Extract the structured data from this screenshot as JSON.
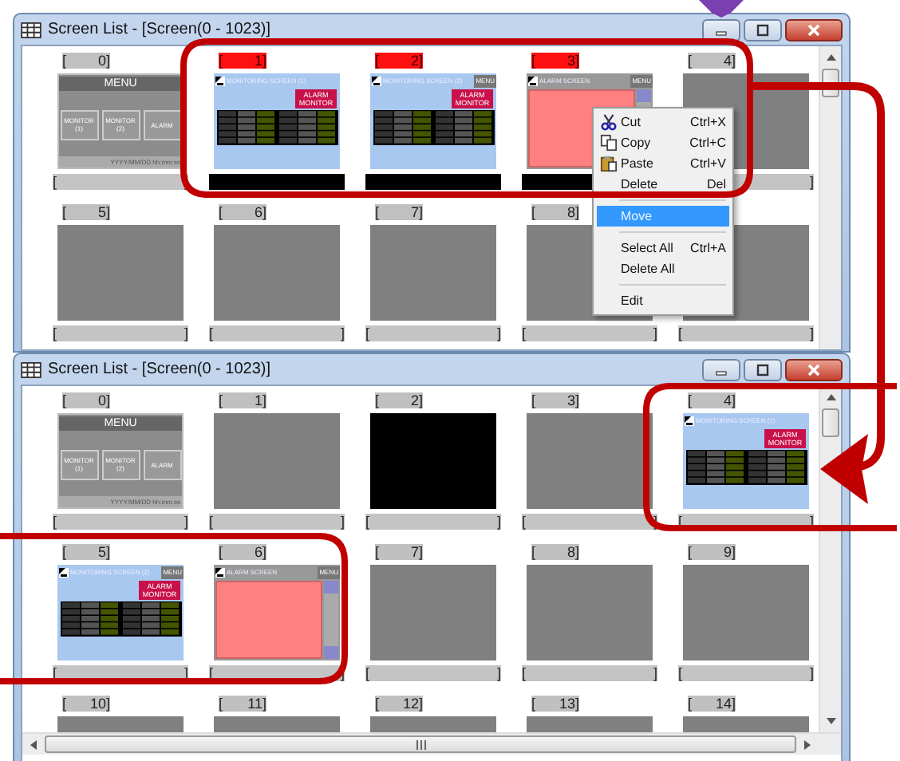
{
  "brackets": {
    "open": "[",
    "close": "]"
  },
  "windows": [
    {
      "title": "Screen List - [Screen(0 - 1023)]",
      "rows": [
        {
          "cut_off": false,
          "items": [
            {
              "number": "0",
              "kind": "menu",
              "selected": false,
              "header": "MENU",
              "buttons": [
                "MONITOR (1)",
                "MONITOR (2)",
                "ALARM"
              ],
              "footer": "YYYY/MM/DD hh:mm:ss"
            },
            {
              "number": "1",
              "kind": "monitor",
              "selected": true,
              "header": "MONITORING SCREEN (1)",
              "alarm_button": "ALARM MONITOR"
            },
            {
              "number": "2",
              "kind": "monitor",
              "selected": true,
              "header": "MONITORING SCREEN (2)",
              "menu_button": "MENU",
              "alarm_button": "ALARM MONITOR"
            },
            {
              "number": "3",
              "kind": "alarm",
              "selected": true,
              "header": "ALARM SCREEN",
              "menu_button": "MENU"
            },
            {
              "number": "4",
              "kind": "blank",
              "selected": false
            }
          ]
        },
        {
          "cut_off": false,
          "items": [
            {
              "number": "5",
              "kind": "blank",
              "selected": false
            },
            {
              "number": "6",
              "kind": "blank",
              "selected": false
            },
            {
              "number": "7",
              "kind": "blank",
              "selected": false
            },
            {
              "number": "8",
              "kind": "blank",
              "selected": false
            },
            {
              "kind": "blank",
              "selected": false
            }
          ]
        }
      ],
      "context_menu": [
        {
          "kind": "item",
          "label": "Cut",
          "shortcut": "Ctrl+X",
          "selected": false
        },
        {
          "kind": "item",
          "label": "Copy",
          "shortcut": "Ctrl+C",
          "selected": false
        },
        {
          "kind": "item",
          "label": "Paste",
          "shortcut": "Ctrl+V",
          "selected": false
        },
        {
          "kind": "item",
          "label": "Delete",
          "shortcut": "Del",
          "selected": false
        },
        {
          "kind": "separator"
        },
        {
          "kind": "item",
          "label": "Move",
          "selected": true
        },
        {
          "kind": "separator"
        },
        {
          "kind": "item",
          "label": "Select All",
          "shortcut": "Ctrl+A",
          "selected": false
        },
        {
          "kind": "item",
          "label": "Delete All",
          "selected": false
        },
        {
          "kind": "separator"
        },
        {
          "kind": "item",
          "label": "Edit",
          "selected": false
        }
      ]
    },
    {
      "title": "Screen List - [Screen(0 - 1023)]",
      "rows": [
        {
          "cut_off": false,
          "items": [
            {
              "number": "0",
              "kind": "menu",
              "selected": false,
              "header": "MENU",
              "buttons": [
                "MONITOR (1)",
                "MONITOR (2)",
                "ALARM"
              ],
              "footer": "YYYY/MM/DD hh:mm:ss"
            },
            {
              "number": "1",
              "kind": "blank",
              "selected": false
            },
            {
              "number": "2",
              "kind": "black",
              "selected": false
            },
            {
              "number": "3",
              "kind": "blank",
              "selected": false
            },
            {
              "number": "4",
              "kind": "monitor",
              "selected": false,
              "header": "MONITORING SCREEN (1)",
              "alarm_button": "ALARM MONITOR"
            }
          ]
        },
        {
          "cut_off": false,
          "items": [
            {
              "number": "5",
              "kind": "monitor",
              "selected": false,
              "header": "MONITORING SCREEN (2)",
              "menu_button": "MENU",
              "alarm_button": "ALARM MONITOR"
            },
            {
              "number": "6",
              "kind": "alarm",
              "selected": false,
              "header": "ALARM SCREEN",
              "menu_button": "MENU"
            },
            {
              "number": "7",
              "kind": "blank",
              "selected": false
            },
            {
              "number": "8",
              "kind": "blank",
              "selected": false
            },
            {
              "number": "9",
              "kind": "blank",
              "selected": false
            }
          ]
        },
        {
          "cut_off": true,
          "items": [
            {
              "number": "10",
              "kind": "blank",
              "selected": false
            },
            {
              "number": "11",
              "kind": "blank",
              "selected": false
            },
            {
              "number": "12",
              "kind": "blank",
              "selected": false
            },
            {
              "number": "13",
              "kind": "blank",
              "selected": false
            },
            {
              "number": "14",
              "kind": "blank",
              "selected": false
            }
          ]
        }
      ],
      "horizontal_scrollbar": true
    }
  ]
}
